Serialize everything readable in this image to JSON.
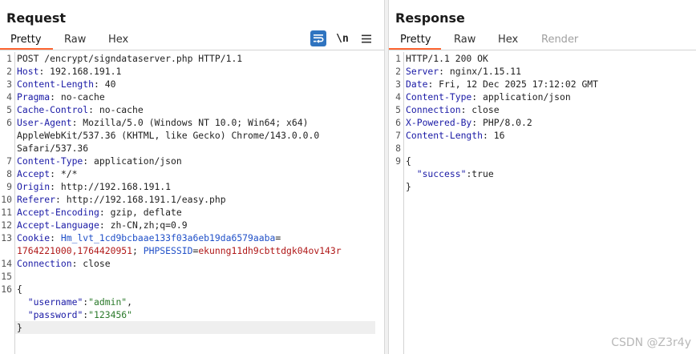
{
  "request": {
    "title": "Request",
    "tabs": [
      "Pretty",
      "Raw",
      "Hex"
    ],
    "toolbar": {
      "wrap_icon": "wrap-lines-icon",
      "newline_label": "\\n",
      "menu_icon": "hamburger-menu-icon"
    },
    "lines": [
      {
        "n": "1",
        "parts": [
          [
            "pl",
            "POST /encrypt/signdataserver.php HTTP/1.1"
          ]
        ]
      },
      {
        "n": "2",
        "parts": [
          [
            "k",
            "Host"
          ],
          [
            "pl",
            ": 192.168.191.1"
          ]
        ]
      },
      {
        "n": "3",
        "parts": [
          [
            "k",
            "Content-Length"
          ],
          [
            "pl",
            ": 40"
          ]
        ]
      },
      {
        "n": "4",
        "parts": [
          [
            "k",
            "Pragma"
          ],
          [
            "pl",
            ": no-cache"
          ]
        ]
      },
      {
        "n": "5",
        "parts": [
          [
            "k",
            "Cache-Control"
          ],
          [
            "pl",
            ": no-cache"
          ]
        ]
      },
      {
        "n": "6",
        "parts": [
          [
            "k",
            "User-Agent"
          ],
          [
            "pl",
            ": Mozilla/5.0 (Windows NT 10.0; Win64; x64)"
          ]
        ]
      },
      {
        "n": "",
        "parts": [
          [
            "pl",
            "AppleWebKit/537.36 (KHTML, like Gecko) Chrome/143.0.0.0"
          ]
        ]
      },
      {
        "n": "",
        "parts": [
          [
            "pl",
            "Safari/537.36"
          ]
        ]
      },
      {
        "n": "7",
        "parts": [
          [
            "k",
            "Content-Type"
          ],
          [
            "pl",
            ": application/json"
          ]
        ]
      },
      {
        "n": "8",
        "parts": [
          [
            "k",
            "Accept"
          ],
          [
            "pl",
            ": */*"
          ]
        ]
      },
      {
        "n": "9",
        "parts": [
          [
            "k",
            "Origin"
          ],
          [
            "pl",
            ": http://192.168.191.1"
          ]
        ]
      },
      {
        "n": "10",
        "parts": [
          [
            "k",
            "Referer"
          ],
          [
            "pl",
            ": http://192.168.191.1/easy.php"
          ]
        ]
      },
      {
        "n": "11",
        "parts": [
          [
            "k",
            "Accept-Encoding"
          ],
          [
            "pl",
            ": gzip, deflate"
          ]
        ]
      },
      {
        "n": "12",
        "parts": [
          [
            "k",
            "Accept-Language"
          ],
          [
            "pl",
            ": zh-CN,zh;q=0.9"
          ]
        ]
      },
      {
        "n": "13",
        "parts": [
          [
            "k",
            "Cookie"
          ],
          [
            "pl",
            ": "
          ],
          [
            "ck",
            "Hm_lvt_1cd9bcbaae133f03a6eb19da6579aaba"
          ],
          [
            "pl",
            "="
          ]
        ]
      },
      {
        "n": "",
        "parts": [
          [
            "cv",
            "1764221000,1764420951"
          ],
          [
            "pl",
            "; "
          ],
          [
            "ck",
            "PHPSESSID"
          ],
          [
            "pl",
            "="
          ],
          [
            "cv",
            "ekunng11dh9cbttdgk04ov143r"
          ]
        ]
      },
      {
        "n": "14",
        "parts": [
          [
            "k",
            "Connection"
          ],
          [
            "pl",
            ": close"
          ]
        ]
      },
      {
        "n": "15",
        "parts": [
          [
            "pl",
            ""
          ]
        ]
      },
      {
        "n": "16",
        "parts": [
          [
            "pl",
            "{"
          ]
        ]
      },
      {
        "n": "",
        "parts": [
          [
            "pl",
            "  "
          ],
          [
            "k",
            "\"username\""
          ],
          [
            "pl",
            ":"
          ],
          [
            "s",
            "\"admin\""
          ],
          [
            "pl",
            ","
          ]
        ]
      },
      {
        "n": "",
        "parts": [
          [
            "pl",
            "  "
          ],
          [
            "k",
            "\"password\""
          ],
          [
            "pl",
            ":"
          ],
          [
            "s",
            "\"123456\""
          ]
        ]
      },
      {
        "n": "",
        "parts": [
          [
            "pl",
            "}"
          ]
        ]
      }
    ]
  },
  "response": {
    "title": "Response",
    "tabs": [
      "Pretty",
      "Raw",
      "Hex",
      "Render"
    ],
    "lines": [
      {
        "n": "1",
        "parts": [
          [
            "pl",
            "HTTP/1.1 200 OK"
          ]
        ]
      },
      {
        "n": "2",
        "parts": [
          [
            "k",
            "Server"
          ],
          [
            "pl",
            ": nginx/1.15.11"
          ]
        ]
      },
      {
        "n": "3",
        "parts": [
          [
            "k",
            "Date"
          ],
          [
            "pl",
            ": Fri, 12 Dec 2025 17:12:02 GMT"
          ]
        ]
      },
      {
        "n": "4",
        "parts": [
          [
            "k",
            "Content-Type"
          ],
          [
            "pl",
            ": application/json"
          ]
        ]
      },
      {
        "n": "5",
        "parts": [
          [
            "k",
            "Connection"
          ],
          [
            "pl",
            ": close"
          ]
        ]
      },
      {
        "n": "6",
        "parts": [
          [
            "k",
            "X-Powered-By"
          ],
          [
            "pl",
            ": PHP/8.0.2"
          ]
        ]
      },
      {
        "n": "7",
        "parts": [
          [
            "k",
            "Content-Length"
          ],
          [
            "pl",
            ": 16"
          ]
        ]
      },
      {
        "n": "8",
        "parts": [
          [
            "pl",
            ""
          ]
        ]
      },
      {
        "n": "9",
        "parts": [
          [
            "pl",
            "{"
          ]
        ]
      },
      {
        "n": "",
        "parts": [
          [
            "pl",
            "  "
          ],
          [
            "k",
            "\"success\""
          ],
          [
            "pl",
            ":true"
          ]
        ]
      },
      {
        "n": "",
        "parts": [
          [
            "pl",
            "}"
          ]
        ]
      }
    ]
  },
  "watermark": "CSDN @Z3r4y",
  "colors": {
    "accent": "#ff6633",
    "toolbar_active": "#2f74c0",
    "header_key": "#1a1aa6",
    "string": "#2b7a2b",
    "cookie_name": "#2050c8",
    "cookie_value": "#b01818"
  }
}
